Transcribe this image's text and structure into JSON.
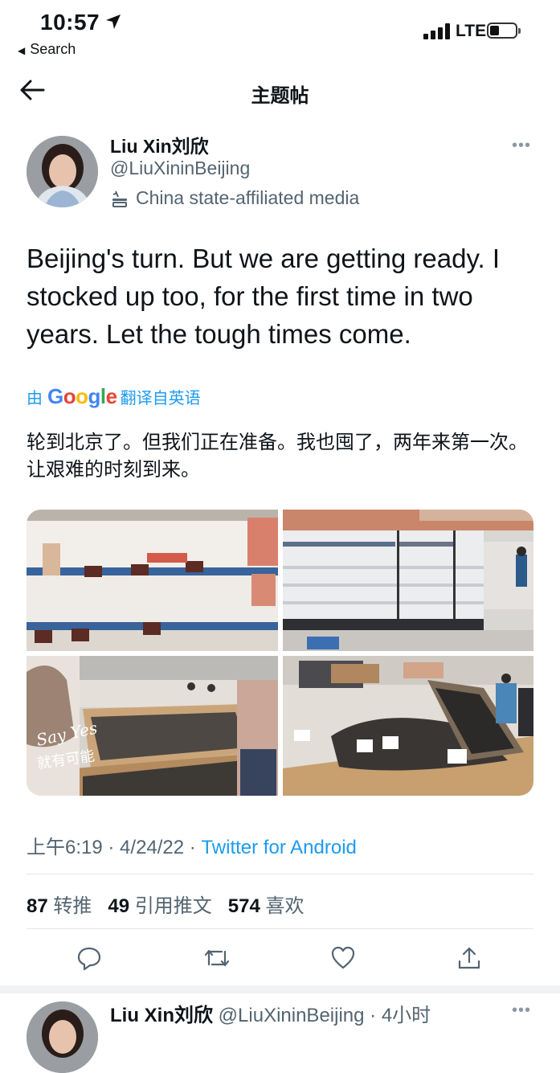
{
  "status_bar": {
    "time": "10:57",
    "back_label": "Search",
    "network": "LTE"
  },
  "nav": {
    "title": "主题帖"
  },
  "tweet": {
    "author_name": "Liu Xin刘欣",
    "author_handle": "@LiuXininBeijing",
    "affiliation": "China state-affiliated media",
    "text": "Beijing's turn. But we are getting ready. I stocked up too, for the first time in two years. Let the tough times come.",
    "translate_prefix": "由",
    "translate_brand": "Google",
    "translate_suffix": "翻译自英语",
    "translated_text": "轮到北京了。但我们正在准备。我也囤了，两年来第一次。让艰难的时刻到来。",
    "photo_overlay_line1": "Say Yes",
    "photo_overlay_line2": "就有可能",
    "time": "上午6:19",
    "date": "4/24/22",
    "source": "Twitter for Android",
    "retweets": "87",
    "retweets_label": "转推",
    "quotes": "49",
    "quotes_label": "引用推文",
    "likes": "574",
    "likes_label": "喜欢"
  },
  "reply": {
    "author_name": "Liu Xin刘欣",
    "author_handle": "@LiuXininBeijing",
    "time_ago": "4小时"
  },
  "colors": {
    "accent": "#1d9bf0",
    "secondary_text": "#536471",
    "primary_text": "#0f1419"
  },
  "icons": [
    "location-arrow-icon",
    "signal-icon",
    "battery-icon",
    "back-arrow-icon",
    "more-icon",
    "state-media-icon",
    "reply-icon",
    "retweet-icon",
    "like-icon",
    "share-icon"
  ]
}
